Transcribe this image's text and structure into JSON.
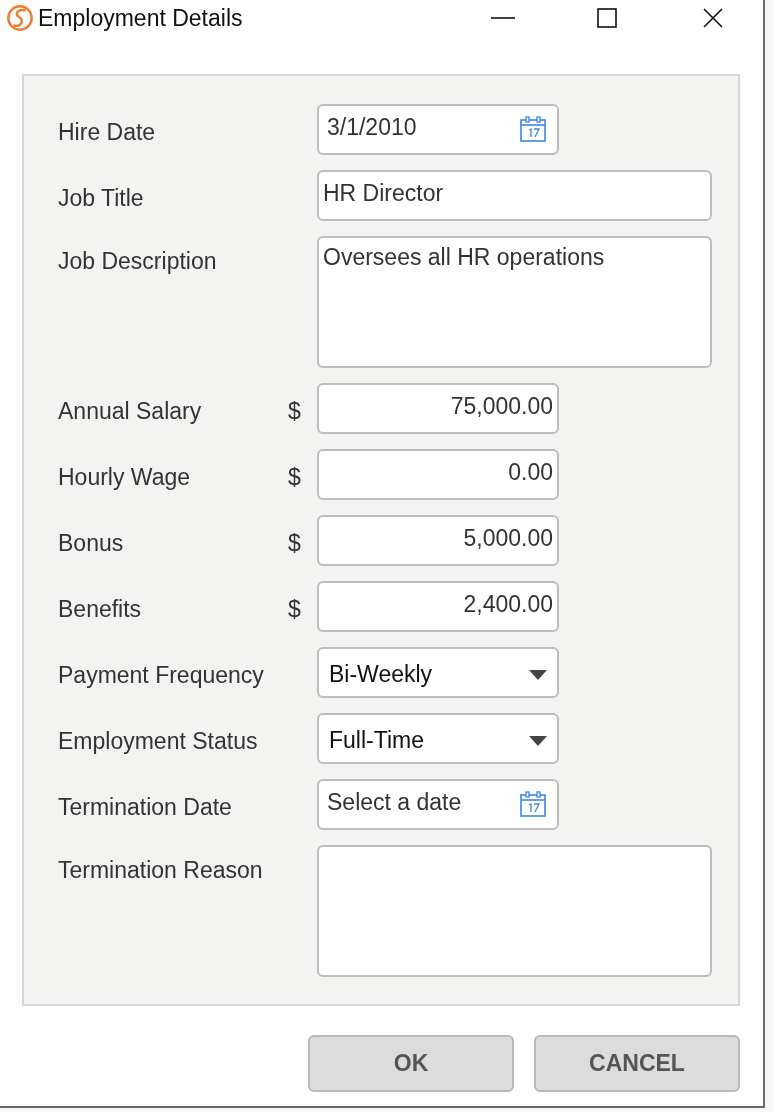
{
  "window": {
    "title": "Employment Details"
  },
  "fields": [
    {
      "kind": "date",
      "label": "Hire Date",
      "value": "3/1/2010"
    },
    {
      "kind": "text",
      "label": "Job Title",
      "value": "HR Director"
    },
    {
      "kind": "textarea",
      "label": "Job Description",
      "value": "Oversees all HR operations"
    },
    {
      "kind": "currency",
      "label": "Annual Salary",
      "currency": "$",
      "value": "75,000.00"
    },
    {
      "kind": "currency",
      "label": "Hourly Wage",
      "currency": "$",
      "value": "0.00"
    },
    {
      "kind": "currency",
      "label": "Bonus",
      "currency": "$",
      "value": "5,000.00"
    },
    {
      "kind": "currency",
      "label": "Benefits",
      "currency": "$",
      "value": "2,400.00"
    },
    {
      "kind": "select",
      "label": "Payment Frequency",
      "value": "Bi-Weekly"
    },
    {
      "kind": "select",
      "label": "Employment Status",
      "value": "Full-Time"
    },
    {
      "kind": "date",
      "label": "Termination Date",
      "placeholder": "Select a date"
    },
    {
      "kind": "textarea",
      "label": "Termination Reason"
    }
  ],
  "buttons": [
    "OK",
    "CANCEL"
  ]
}
